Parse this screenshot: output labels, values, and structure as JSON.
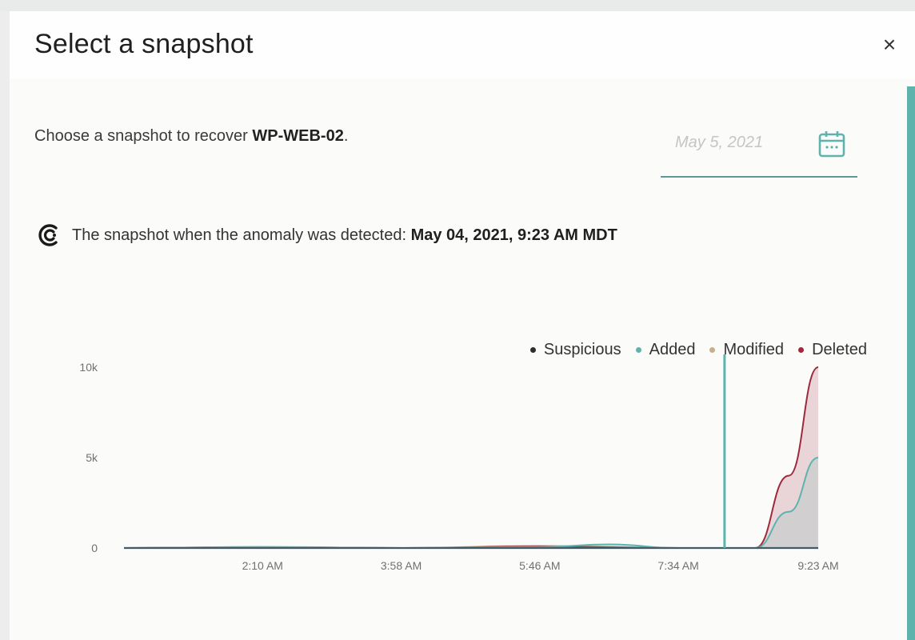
{
  "modal": {
    "title": "Select a snapshot",
    "close_icon": "close-icon",
    "close_label": "×"
  },
  "recover": {
    "prefix": "Choose a snapshot to recover ",
    "target": "WP-WEB-02",
    "suffix": "."
  },
  "date_picker": {
    "placeholder": "May 5, 2021",
    "icon": "calendar-icon",
    "accent": "#5b9a98"
  },
  "anomaly": {
    "icon": "logo-c-icon",
    "label": "The snapshot when the anomaly was detected: ",
    "timestamp": "May 04, 2021, 9:23 AM MDT"
  },
  "colors": {
    "suspicious": "#2d2d2d",
    "added": "#5fb3ad",
    "modified": "#c9ad8a",
    "deleted": "#9c2a3c"
  },
  "chart_data": {
    "type": "area",
    "legend": [
      "Suspicious",
      "Added",
      "Modified",
      "Deleted"
    ],
    "legend_position": "top-right",
    "x_ticks": [
      "2:10 AM",
      "3:58 AM",
      "5:46 AM",
      "7:34 AM",
      "9:23 AM"
    ],
    "y_ticks": [
      "0",
      "5k",
      "10k"
    ],
    "ylim": [
      0,
      10000
    ],
    "selected_marker_x": "8:10 AM",
    "series": [
      {
        "name": "Deleted",
        "x": [
          "12:22 AM",
          "2:10 AM",
          "3:58 AM",
          "5:46 AM",
          "7:34 AM",
          "8:34 AM",
          "9:00 AM",
          "9:23 AM"
        ],
        "values": [
          0,
          50,
          0,
          80,
          0,
          0,
          4000,
          10000
        ]
      },
      {
        "name": "Added",
        "x": [
          "12:22 AM",
          "2:10 AM",
          "3:58 AM",
          "5:46 AM",
          "6:40 AM",
          "7:34 AM",
          "8:34 AM",
          "9:00 AM",
          "9:23 AM"
        ],
        "values": [
          0,
          60,
          0,
          50,
          200,
          0,
          0,
          2000,
          5000
        ]
      },
      {
        "name": "Modified",
        "x": [
          "12:22 AM",
          "2:10 AM",
          "3:58 AM",
          "5:46 AM",
          "7:34 AM",
          "9:23 AM"
        ],
        "values": [
          0,
          30,
          0,
          120,
          0,
          0
        ]
      },
      {
        "name": "Suspicious",
        "x": [
          "12:22 AM",
          "9:23 AM"
        ],
        "values": [
          0,
          0
        ]
      }
    ]
  }
}
